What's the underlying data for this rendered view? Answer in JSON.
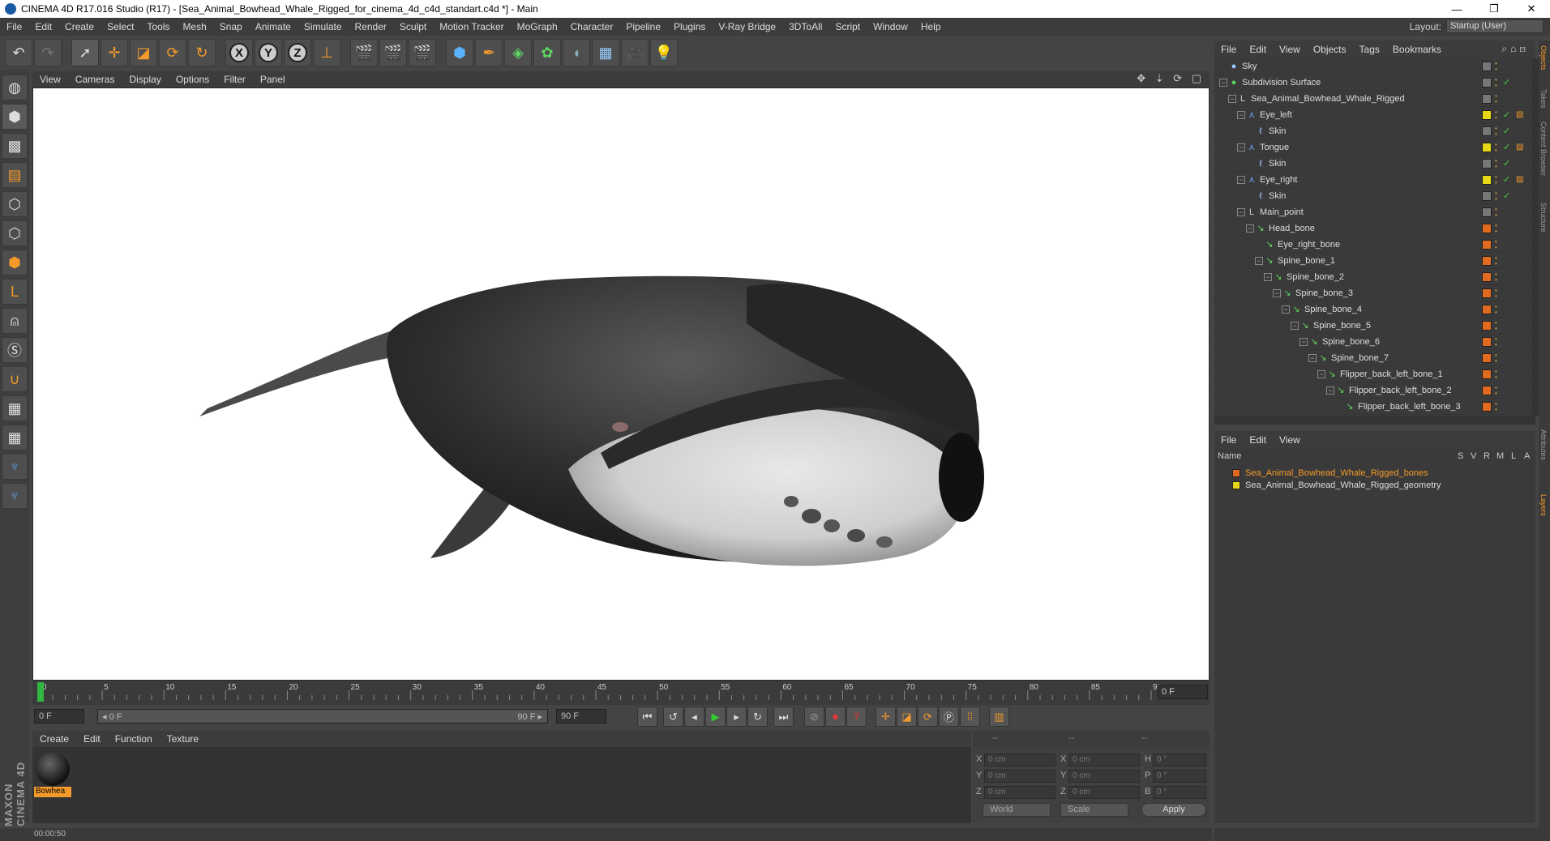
{
  "window": {
    "title": "CINEMA 4D R17.016 Studio (R17) - [Sea_Animal_Bowhead_Whale_Rigged_for_cinema_4d_c4d_standart.c4d *] - Main",
    "controls": [
      "—",
      "❐",
      "✕"
    ]
  },
  "menubar": {
    "items": [
      "File",
      "Edit",
      "Create",
      "Select",
      "Tools",
      "Mesh",
      "Snap",
      "Animate",
      "Simulate",
      "Render",
      "Sculpt",
      "Motion Tracker",
      "MoGraph",
      "Character",
      "Pipeline",
      "Plugins",
      "V-Ray Bridge",
      "3DToAll",
      "Script",
      "Window",
      "Help"
    ],
    "layout_label": "Layout:",
    "layout_value": "Startup (User)"
  },
  "toolbar": {
    "axis_x": "X",
    "axis_y": "Y",
    "axis_z": "Z"
  },
  "viewport": {
    "menu": [
      "View",
      "Cameras",
      "Display",
      "Options",
      "Filter",
      "Panel"
    ],
    "nav_icons": "✥ ⇣ ⟳ ▢"
  },
  "timeline": {
    "ticks": [
      "0",
      "5",
      "10",
      "15",
      "20",
      "25",
      "30",
      "35",
      "40",
      "45",
      "50",
      "55",
      "60",
      "65",
      "70",
      "75",
      "80",
      "85",
      "90"
    ],
    "current_frame": "0 F"
  },
  "transport": {
    "start_field": "0 F",
    "range_start": "◂ 0 F",
    "range_end": "90 F ▸",
    "end_field": "90 F"
  },
  "material_manager": {
    "menu": [
      "Create",
      "Edit",
      "Function",
      "Texture"
    ],
    "material_name": "Bowhea"
  },
  "coordinates": {
    "header": [
      "--",
      "--",
      "--"
    ],
    "rows": [
      {
        "a": "X",
        "v1": "0 cm",
        "b": "X",
        "v2": "0 cm",
        "c": "H",
        "v3": "0 °"
      },
      {
        "a": "Y",
        "v1": "0 cm",
        "b": "Y",
        "v2": "0 cm",
        "c": "P",
        "v3": "0 °"
      },
      {
        "a": "Z",
        "v1": "0 cm",
        "b": "Z",
        "v2": "0 cm",
        "c": "B",
        "v3": "0 °"
      }
    ],
    "space": "World",
    "mode": "Scale",
    "apply": "Apply"
  },
  "status": {
    "time": "00:00:50"
  },
  "brand": "MAXON CINEMA 4D",
  "object_manager": {
    "menu": [
      "File",
      "Edit",
      "View",
      "Objects",
      "Tags",
      "Bookmarks"
    ],
    "objects": [
      {
        "name": "Sky",
        "depth": 0,
        "exp": "",
        "icon": "sky",
        "tag": "gray",
        "check": ""
      },
      {
        "name": "Subdivision Surface",
        "depth": 0,
        "exp": "−",
        "icon": "sub",
        "tag": "gray",
        "check": "✓"
      },
      {
        "name": "Sea_Animal_Bowhead_Whale_Rigged",
        "depth": 1,
        "exp": "−",
        "icon": "null",
        "tag": "gray",
        "check": ""
      },
      {
        "name": "Eye_left",
        "depth": 2,
        "exp": "−",
        "icon": "joint",
        "tag": "yellow",
        "check": "✓"
      },
      {
        "name": "Skin",
        "depth": 3,
        "exp": "",
        "icon": "skin",
        "tag": "gray",
        "check": "✓"
      },
      {
        "name": "Tongue",
        "depth": 2,
        "exp": "−",
        "icon": "joint",
        "tag": "yellow",
        "check": "✓"
      },
      {
        "name": "Skin",
        "depth": 3,
        "exp": "",
        "icon": "skin",
        "tag": "gray",
        "check": "✓"
      },
      {
        "name": "Eye_right",
        "depth": 2,
        "exp": "−",
        "icon": "joint",
        "tag": "yellow",
        "check": "✓"
      },
      {
        "name": "Skin",
        "depth": 3,
        "exp": "",
        "icon": "skin",
        "tag": "gray",
        "check": "✓"
      },
      {
        "name": "Main_point",
        "depth": 2,
        "exp": "−",
        "icon": "null",
        "tag": "gray",
        "check": ""
      },
      {
        "name": "Head_bone",
        "depth": 3,
        "exp": "−",
        "icon": "bone",
        "tag": "orange",
        "check": ""
      },
      {
        "name": "Eye_right_bone",
        "depth": 4,
        "exp": "",
        "icon": "bone",
        "tag": "orange",
        "check": ""
      },
      {
        "name": "Spine_bone_1",
        "depth": 4,
        "exp": "−",
        "icon": "bone",
        "tag": "orange",
        "check": ""
      },
      {
        "name": "Spine_bone_2",
        "depth": 5,
        "exp": "−",
        "icon": "bone",
        "tag": "orange",
        "check": ""
      },
      {
        "name": "Spine_bone_3",
        "depth": 6,
        "exp": "−",
        "icon": "bone",
        "tag": "orange",
        "check": ""
      },
      {
        "name": "Spine_bone_4",
        "depth": 7,
        "exp": "−",
        "icon": "bone",
        "tag": "orange",
        "check": ""
      },
      {
        "name": "Spine_bone_5",
        "depth": 8,
        "exp": "−",
        "icon": "bone",
        "tag": "orange",
        "check": ""
      },
      {
        "name": "Spine_bone_6",
        "depth": 9,
        "exp": "−",
        "icon": "bone",
        "tag": "orange",
        "check": ""
      },
      {
        "name": "Spine_bone_7",
        "depth": 10,
        "exp": "−",
        "icon": "bone",
        "tag": "orange",
        "check": ""
      },
      {
        "name": "Flipper_back_left_bone_1",
        "depth": 11,
        "exp": "−",
        "icon": "bone",
        "tag": "orange",
        "check": ""
      },
      {
        "name": "Flipper_back_left_bone_2",
        "depth": 12,
        "exp": "−",
        "icon": "bone",
        "tag": "orange",
        "check": ""
      },
      {
        "name": "Flipper_back_left_bone_3",
        "depth": 13,
        "exp": "",
        "icon": "bone",
        "tag": "orange",
        "check": ""
      }
    ]
  },
  "layer_manager": {
    "menu": [
      "File",
      "Edit",
      "View"
    ],
    "columns": [
      "Name",
      "S",
      "V",
      "R",
      "M",
      "L",
      "A"
    ],
    "layers": [
      {
        "name": "Sea_Animal_Bowhead_Whale_Rigged_bones",
        "color": "#e06b20",
        "text_color": "#f39a2b"
      },
      {
        "name": "Sea_Animal_Bowhead_Whale_Rigged_geometry",
        "color": "#e6d817",
        "text_color": "#dddddd"
      }
    ]
  },
  "side_tabs": [
    "Objects",
    "Takes",
    "Content Browser",
    "Structure",
    "Attributes",
    "Layers"
  ],
  "colors": {
    "accent": "#f39a2b",
    "panel": "#3a3a3a",
    "viewport_bg": "#ffffff",
    "playhead": "#2ecc40"
  }
}
